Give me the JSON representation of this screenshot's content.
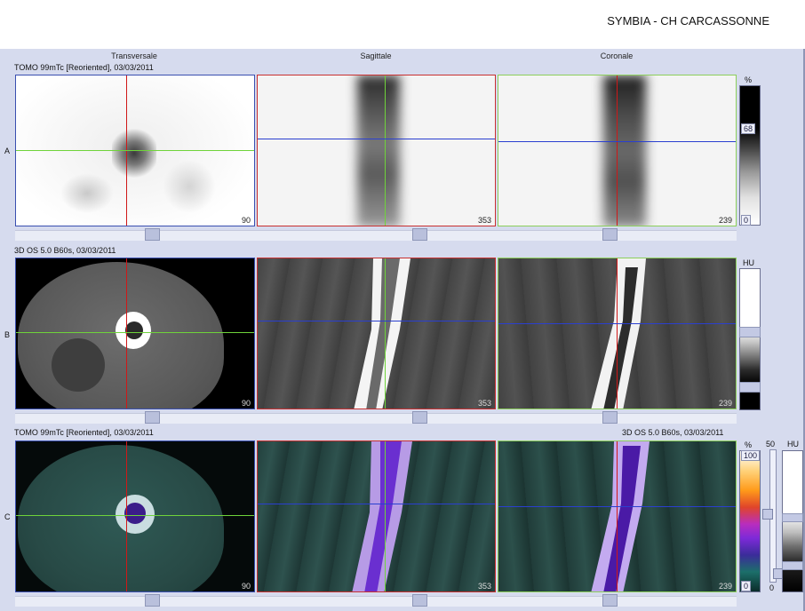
{
  "header": {
    "site_title": "SYMBIA - CH CARCASSONNE"
  },
  "columns": {
    "transversal": "Transversale",
    "sagittal": "Sagittale",
    "coronal": "Coronale"
  },
  "rows": {
    "a": {
      "letter": "A",
      "series_label": "TOMO 99mTc [Reoriented], 03/03/2011"
    },
    "b": {
      "letter": "B",
      "series_label": "3D  OS  5.0  B60s, 03/03/2011"
    },
    "c": {
      "letter": "C",
      "series_label": "TOMO 99mTc [Reoriented], 03/03/2011",
      "series_label_right": "3D  OS  5.0  B60s, 03/03/2011"
    }
  },
  "slices": {
    "transversal": "90",
    "sagittal": "353",
    "coronal": "239"
  },
  "colorbars": {
    "a": {
      "unit": "%",
      "level": "68",
      "min": "0"
    },
    "b": {
      "unit": "HU"
    },
    "c": {
      "unit": "%",
      "max": "100",
      "min": "0",
      "mid_value": "50",
      "ct_unit": "HU",
      "ct_min": "0"
    }
  },
  "colors": {
    "transversal_frame": "#3a4fb0",
    "sagittal_frame": "#c83030",
    "coronal_frame": "#8ccf5a",
    "crosshair_red": "#d01818",
    "crosshair_green": "#6fd33a",
    "crosshair_blue": "#2a3fd0",
    "workspace": "#d6dbee"
  }
}
